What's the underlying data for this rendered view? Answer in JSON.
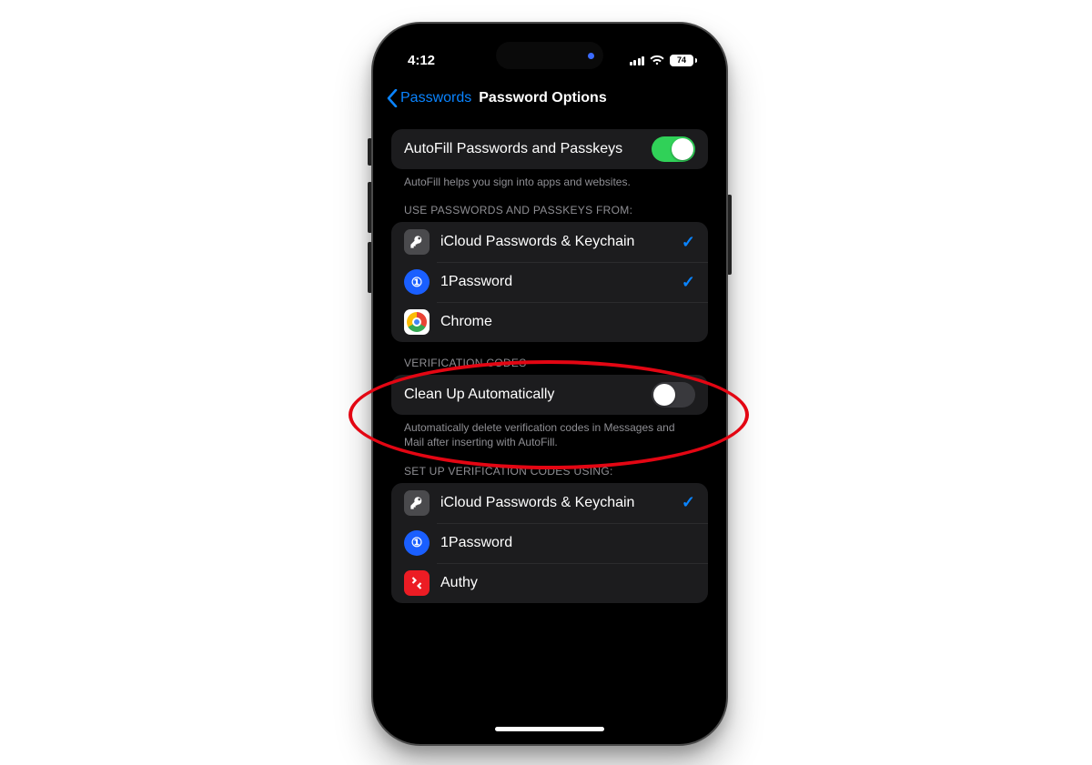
{
  "statusbar": {
    "time": "4:12",
    "battery": "74"
  },
  "nav": {
    "back_label": "Passwords",
    "title": "Password Options"
  },
  "section_autofill": {
    "row_label": "AutoFill Passwords and Passkeys",
    "toggle_on": true,
    "footer": "AutoFill helps you sign into apps and websites."
  },
  "section_sources": {
    "header": "USE PASSWORDS AND PASSKEYS FROM:",
    "items": [
      {
        "label": "iCloud Passwords & Keychain",
        "icon": "key",
        "checked": true
      },
      {
        "label": "1Password",
        "icon": "1password",
        "checked": true
      },
      {
        "label": "Chrome",
        "icon": "chrome",
        "checked": false
      }
    ]
  },
  "section_verification": {
    "header": "VERIFICATION CODES",
    "row_label": "Clean Up Automatically",
    "toggle_on": false,
    "footer": "Automatically delete verification codes in Messages and Mail after inserting with AutoFill."
  },
  "section_setup": {
    "header": "SET UP VERIFICATION CODES USING:",
    "items": [
      {
        "label": "iCloud Passwords & Keychain",
        "icon": "key",
        "checked": true
      },
      {
        "label": "1Password",
        "icon": "1password",
        "checked": false
      },
      {
        "label": "Authy",
        "icon": "authy",
        "checked": false
      }
    ]
  }
}
